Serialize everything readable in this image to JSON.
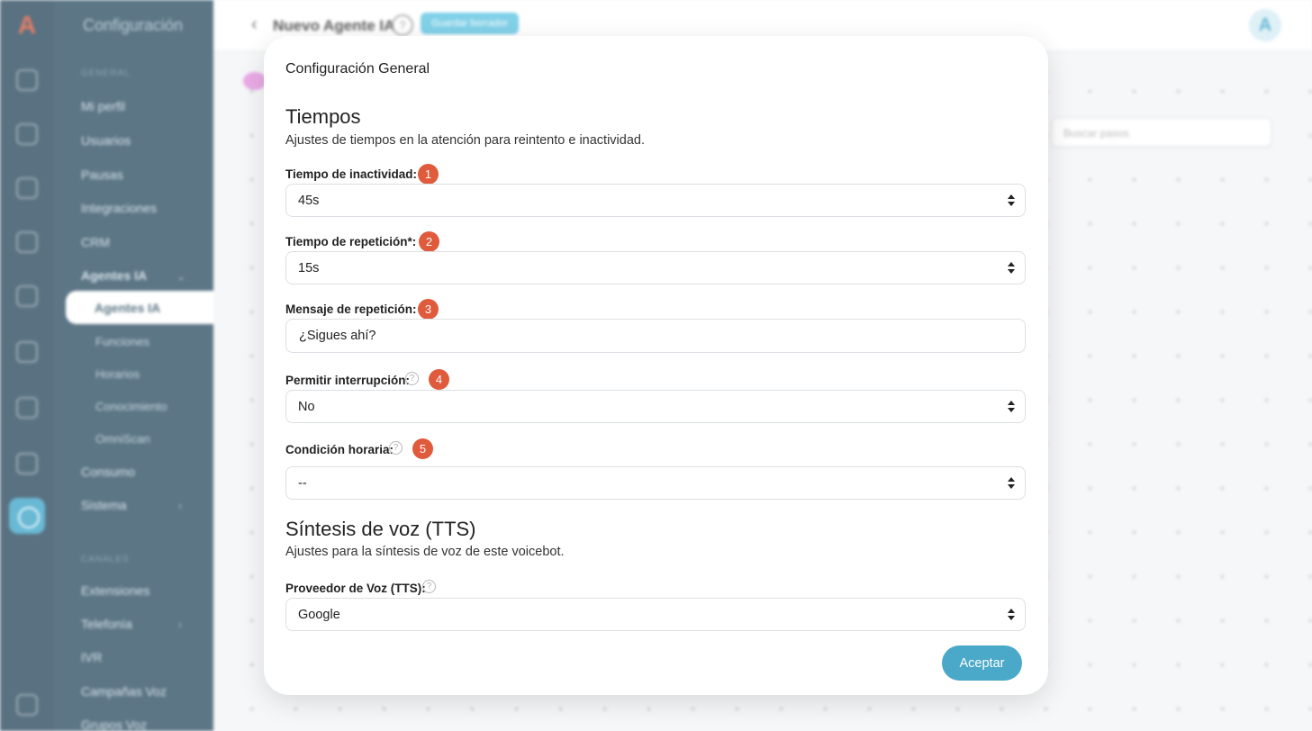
{
  "app": {
    "sidebar_title": "Configuración",
    "section_general": "GENERAL",
    "section_channels": "CANALES",
    "menu": {
      "my_profile": "Mi perfil",
      "users": "Usuarios",
      "pauses": "Pausas",
      "integrations": "Integraciones",
      "crm": "CRM",
      "ai_agents": "Agentes IA",
      "ai_agents_sub": "Agentes IA",
      "functions": "Funciones",
      "schedules": "Horarios",
      "knowledge": "Conocimiento",
      "omniscan": "OmniScan",
      "consumption": "Consumo",
      "system": "Sistema",
      "extensions": "Extensiones",
      "telephony": "Telefonía",
      "ivr": "IVR",
      "voice_campaigns": "Campañas Voz",
      "voice_groups": "Grupos Voz"
    },
    "header": {
      "title": "Nuevo Agente IA",
      "help": "?",
      "save_draft": "Guardar borrador",
      "avatar_letter": "A"
    },
    "search_steps_placeholder": "Buscar pasos",
    "logo": "A",
    "accent": "#3fa6c9",
    "brand": "#e05a3c"
  },
  "modal": {
    "title": "Configuración General",
    "timing": {
      "heading": "Tiempos",
      "description": "Ajustes de tiempos en la atención para reintento e inactividad.",
      "fields": [
        {
          "label": "Tiempo de inactividad:",
          "badge": "1",
          "value": "45s"
        },
        {
          "label": "Tiempo de repetición*:",
          "badge": "2",
          "value": "15s"
        },
        {
          "label": "Mensaje de repetición:",
          "badge": "3",
          "value": "¿Sigues ahí?"
        },
        {
          "label": "Permitir interrupción:",
          "badge": "4",
          "value": "No"
        },
        {
          "label": "Condición horaria:",
          "badge": "5",
          "value": "--"
        }
      ]
    },
    "tts": {
      "heading": "Síntesis de voz (TTS)",
      "description": "Ajustes para la síntesis de voz de este voicebot.",
      "provider_label": "Proveedor de Voz (TTS):",
      "provider_value": "Google"
    },
    "accept_label": "Aceptar",
    "help_glyph": "?"
  }
}
